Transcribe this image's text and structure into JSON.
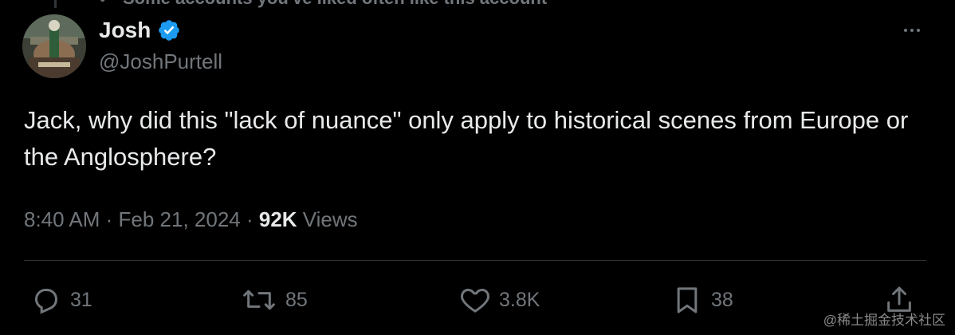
{
  "context": {
    "text": "Some accounts you've liked often like this account"
  },
  "author": {
    "display_name": "Josh",
    "handle": "@JoshPurtell",
    "verified": true,
    "verified_color": "#1d9bf0"
  },
  "tweet": {
    "text": "Jack, why did this \"lack of nuance\" only apply to historical scenes from Europe or the Anglosphere?",
    "time": "8:40 AM",
    "separator": " · ",
    "date": "Feb 21, 2024",
    "views_count": "92K",
    "views_label": " Views"
  },
  "actions": {
    "replies": "31",
    "reposts": "85",
    "likes": "3.8K",
    "bookmarks": "38"
  },
  "icons": {
    "reply": "speech-bubble-icon",
    "repost": "repost-arrows-icon",
    "like": "heart-icon",
    "bookmark": "bookmark-icon",
    "share": "share-upload-icon",
    "more": "more-dots-icon"
  },
  "colors": {
    "background": "#000000",
    "primary_text": "#e7e9ea",
    "secondary_text": "#71767b",
    "divider": "#2f3336"
  },
  "watermark": {
    "text": "@稀土掘金技术社区"
  }
}
